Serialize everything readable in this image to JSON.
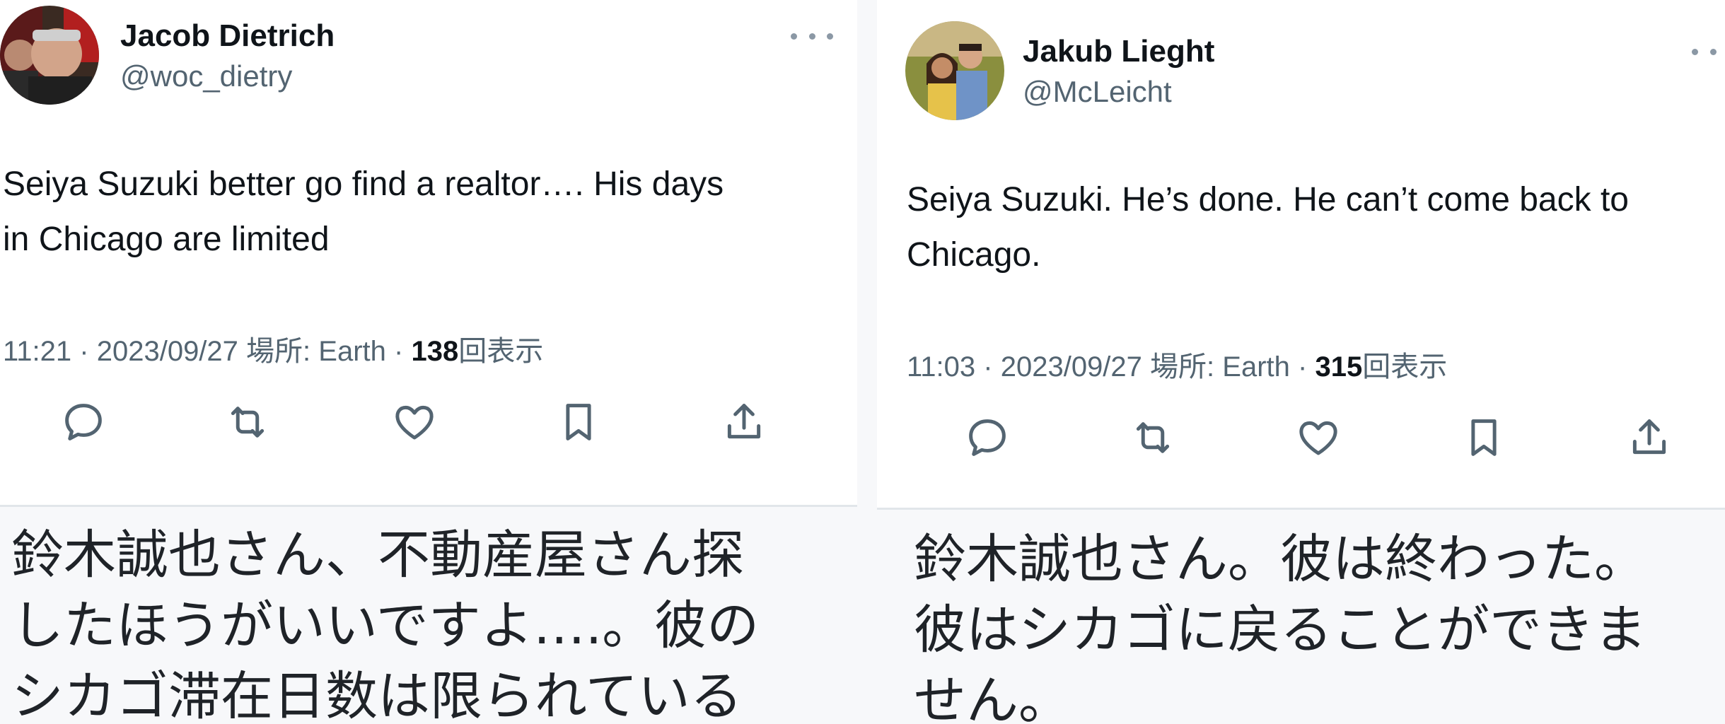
{
  "tweets": [
    {
      "author": {
        "display_name": "Jacob Dietrich",
        "handle": "@woc_dietry",
        "avatar": "profile-photo"
      },
      "more_icon": "more-horizontal-icon",
      "text_lines": [
        "Seiya Suzuki better go find a realtor…. His days",
        "in Chicago are limited"
      ],
      "meta": {
        "time": "11:21",
        "sep1": "·",
        "date": "2023/09/27",
        "location_label": "場所:",
        "location": "Earth",
        "sep2": "·",
        "views_count": "138",
        "views_label": "回表示"
      },
      "actions": [
        "reply-icon",
        "retweet-icon",
        "like-icon",
        "bookmark-icon",
        "share-icon"
      ],
      "translation_lines": [
        "鈴木誠也さん、不動産屋さん探",
        "したほうがいいですよ….。彼の",
        "シカゴ滞在日数は限られている"
      ]
    },
    {
      "author": {
        "display_name": "Jakub Lieght",
        "handle": "@McLeicht",
        "avatar": "profile-photo"
      },
      "more_icon": "more-horizontal-icon",
      "text_lines": [
        "Seiya Suzuki. He’s done. He can’t come back to",
        "Chicago."
      ],
      "meta": {
        "time": "11:03",
        "sep1": "·",
        "date": "2023/09/27",
        "location_label": "場所:",
        "location": "Earth",
        "sep2": "·",
        "views_count": "315",
        "views_label": "回表示"
      },
      "actions": [
        "reply-icon",
        "retweet-icon",
        "like-icon",
        "bookmark-icon",
        "share-icon"
      ],
      "translation_lines": [
        "鈴木誠也さん。彼は終わった。",
        "彼はシカゴに戻ることができま",
        "せん。"
      ]
    }
  ],
  "colors": {
    "text": "#0f1419",
    "secondary": "#536471",
    "icon": "#536471",
    "translation_bg": "#f7f8fa"
  }
}
